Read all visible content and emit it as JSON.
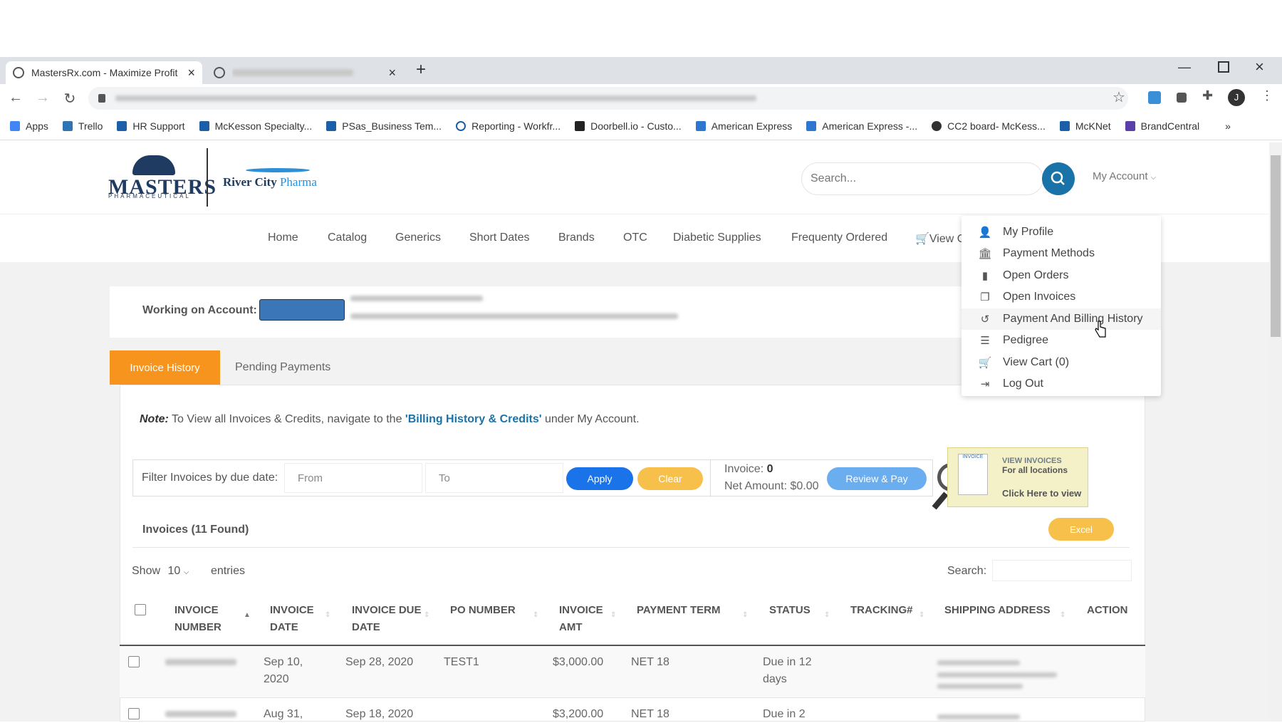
{
  "browser": {
    "tab_active_title": "MastersRx.com - Maximize Profit",
    "tab_close": "×",
    "new_tab": "+",
    "bookmarks": [
      "Apps",
      "Trello",
      "HR Support",
      "McKesson Specialty...",
      "PSas_Business Tem...",
      "Reporting - Workfr...",
      "Doorbell.io - Custo...",
      "American Express",
      "American Express -...",
      "CC2 board- McKess...",
      "McKNet",
      "BrandCentral"
    ],
    "more_bookmarks": "»",
    "profile_initial": "J"
  },
  "header": {
    "logo_masters": "MASTERS",
    "logo_masters_sub": "PHARMACEUTICAL",
    "logo_rc_bold": "River City",
    "logo_rc_light": "Pharma",
    "search_placeholder": "Search...",
    "my_account": "My Account"
  },
  "nav": {
    "items": [
      "Home",
      "Catalog",
      "Generics",
      "Short Dates",
      "Brands",
      "OTC",
      "Diabetic Supplies",
      "Frequenty Ordered"
    ],
    "view_cart_partial": "View C"
  },
  "account": {
    "label": "Working on Account:"
  },
  "tabs": {
    "invoice_history": "Invoice History",
    "pending_payments": "Pending Payments"
  },
  "note": {
    "prefix": "Note:",
    "text1": " To View all Invoices & Credits, navigate to the ",
    "link": "'Billing History & Credits'",
    "text2": " under My Account."
  },
  "filter": {
    "label": "Filter Invoices by due date:",
    "from_placeholder": "From",
    "to_placeholder": "To",
    "apply": "Apply",
    "clear": "Clear",
    "invoice_label": "Invoice:",
    "invoice_count": "0",
    "net_amount": "Net Amount: $0.00",
    "review_pay": "Review & Pay"
  },
  "promo": {
    "line1": "VIEW INVOICES",
    "line2": "For all locations",
    "line3": "Click Here to view",
    "doc_label": "INVOICE"
  },
  "invoices": {
    "title": "Invoices (11 Found)",
    "excel": "Excel",
    "show": "Show",
    "entries_value": "10",
    "entries": "entries",
    "search_label": "Search:",
    "columns": [
      "INVOICE NUMBER",
      "INVOICE DATE",
      "INVOICE DUE DATE",
      "PO NUMBER",
      "INVOICE AMT",
      "PAYMENT TERM",
      "STATUS",
      "TRACKING#",
      "SHIPPING ADDRESS",
      "ACTION"
    ],
    "rows": [
      {
        "invoice_date": "Sep 10, 2020",
        "due_date": "Sep 28, 2020",
        "po_number": "TEST1",
        "amount": "$3,000.00",
        "term": "NET 18",
        "status": "Due in 12 days"
      },
      {
        "invoice_date": "Aug 31,",
        "due_date": "Sep 18, 2020",
        "po_number": "",
        "amount": "$3,200.00",
        "term": "NET 18",
        "status": "Due in 2"
      }
    ]
  },
  "dropdown": {
    "items": [
      {
        "label": "My Profile",
        "icon": "user-icon"
      },
      {
        "label": "Payment Methods",
        "icon": "bank-icon"
      },
      {
        "label": "Open Orders",
        "icon": "file-icon"
      },
      {
        "label": "Open Invoices",
        "icon": "copy-icon"
      },
      {
        "label": "Payment And Billing History",
        "icon": "history-icon"
      },
      {
        "label": "Pedigree",
        "icon": "list-icon"
      },
      {
        "label": "View Cart (0)",
        "icon": "cart-icon"
      },
      {
        "label": "Log Out",
        "icon": "logout-icon"
      }
    ]
  },
  "colors": {
    "accent_orange": "#f7941d",
    "brand_blue": "#1a73a8",
    "apply_blue": "#1a73e8",
    "clear_yellow": "#f7c04a"
  }
}
